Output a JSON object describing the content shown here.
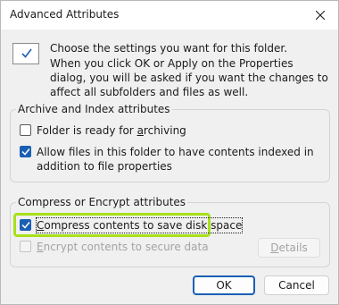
{
  "window": {
    "title": "Advanced Attributes",
    "close_icon": "close-icon"
  },
  "header": {
    "intro": "Choose the settings you want for this folder.",
    "note": "When you click OK or Apply on the Properties dialog, you will be asked if you want the changes to affect all subfolders and files as well."
  },
  "archive_group": {
    "label": "Archive and Index attributes",
    "folder_ready": {
      "prefix": "Folder is ready for ",
      "accel": "a",
      "suffix": "rchiving",
      "checked": false
    },
    "allow_index": {
      "text": "Allow files in this folder to have contents indexed in addition to file properties",
      "checked": true
    }
  },
  "compress_group": {
    "label": "Compress or Encrypt attributes",
    "compress": {
      "accel": "C",
      "suffix": "ompress contents to save disk space",
      "checked": true
    },
    "encrypt": {
      "accel": "E",
      "suffix": "ncrypt contents to secure data",
      "checked": false,
      "enabled": false
    },
    "details_button": {
      "accel": "D",
      "suffix": "etails",
      "enabled": false
    }
  },
  "buttons": {
    "ok": "OK",
    "cancel": "Cancel"
  },
  "colors": {
    "accent": "#1a5fb4",
    "highlight": "#a8e01a"
  }
}
